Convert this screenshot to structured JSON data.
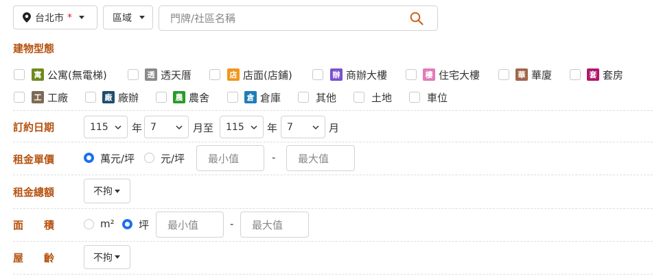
{
  "top": {
    "city": "台北市",
    "required_mark": "*",
    "district": "區域",
    "search_placeholder": "門牌/社區名稱"
  },
  "building_section": {
    "title": "建物型態",
    "types": [
      {
        "tag": "寓",
        "label": "公寓(無電梯)",
        "color": "#6e8a1c"
      },
      {
        "tag": "透",
        "label": "透天厝",
        "color": "#8a8a8a"
      },
      {
        "tag": "店",
        "label": "店面(店鋪)",
        "color": "#f0961e"
      },
      {
        "tag": "辦",
        "label": "商辦大樓",
        "color": "#7b4fd0"
      },
      {
        "tag": "樓",
        "label": "住宅大樓",
        "color": "#e27bb6"
      },
      {
        "tag": "華",
        "label": "華廈",
        "color": "#a0674a"
      },
      {
        "tag": "套",
        "label": "套房",
        "color": "#b0176e"
      },
      {
        "tag": "工",
        "label": "工廠",
        "color": "#7d6a55"
      },
      {
        "tag": "廠",
        "label": "廠辦",
        "color": "#1e4d6e"
      },
      {
        "tag": "農",
        "label": "農舍",
        "color": "#2a9a2a"
      },
      {
        "tag": "倉",
        "label": "倉庫",
        "color": "#1e7db8"
      },
      {
        "tag": "",
        "label": "其他",
        "color": ""
      },
      {
        "tag": "",
        "label": "土地",
        "color": ""
      },
      {
        "tag": "",
        "label": "車位",
        "color": ""
      }
    ]
  },
  "contract_date": {
    "label": "訂約日期",
    "from_year": "115",
    "year_unit": "年",
    "from_month": "7",
    "month_to": "月至",
    "to_year": "115",
    "to_month": "7",
    "month_unit": "月"
  },
  "unit_price": {
    "label": "租金單價",
    "option_1": "萬元/坪",
    "option_2": "元/坪",
    "min_placeholder": "最小值",
    "dash": "-",
    "max_placeholder": "最大值"
  },
  "total_rent": {
    "label": "租金總額",
    "value": "不拘"
  },
  "area": {
    "label": "面　　積",
    "option_1": "m²",
    "option_2": "坪",
    "min_placeholder": "最小值",
    "dash": "-",
    "max_placeholder": "最大值"
  },
  "age": {
    "label": "屋　　齡",
    "value": "不拘"
  }
}
